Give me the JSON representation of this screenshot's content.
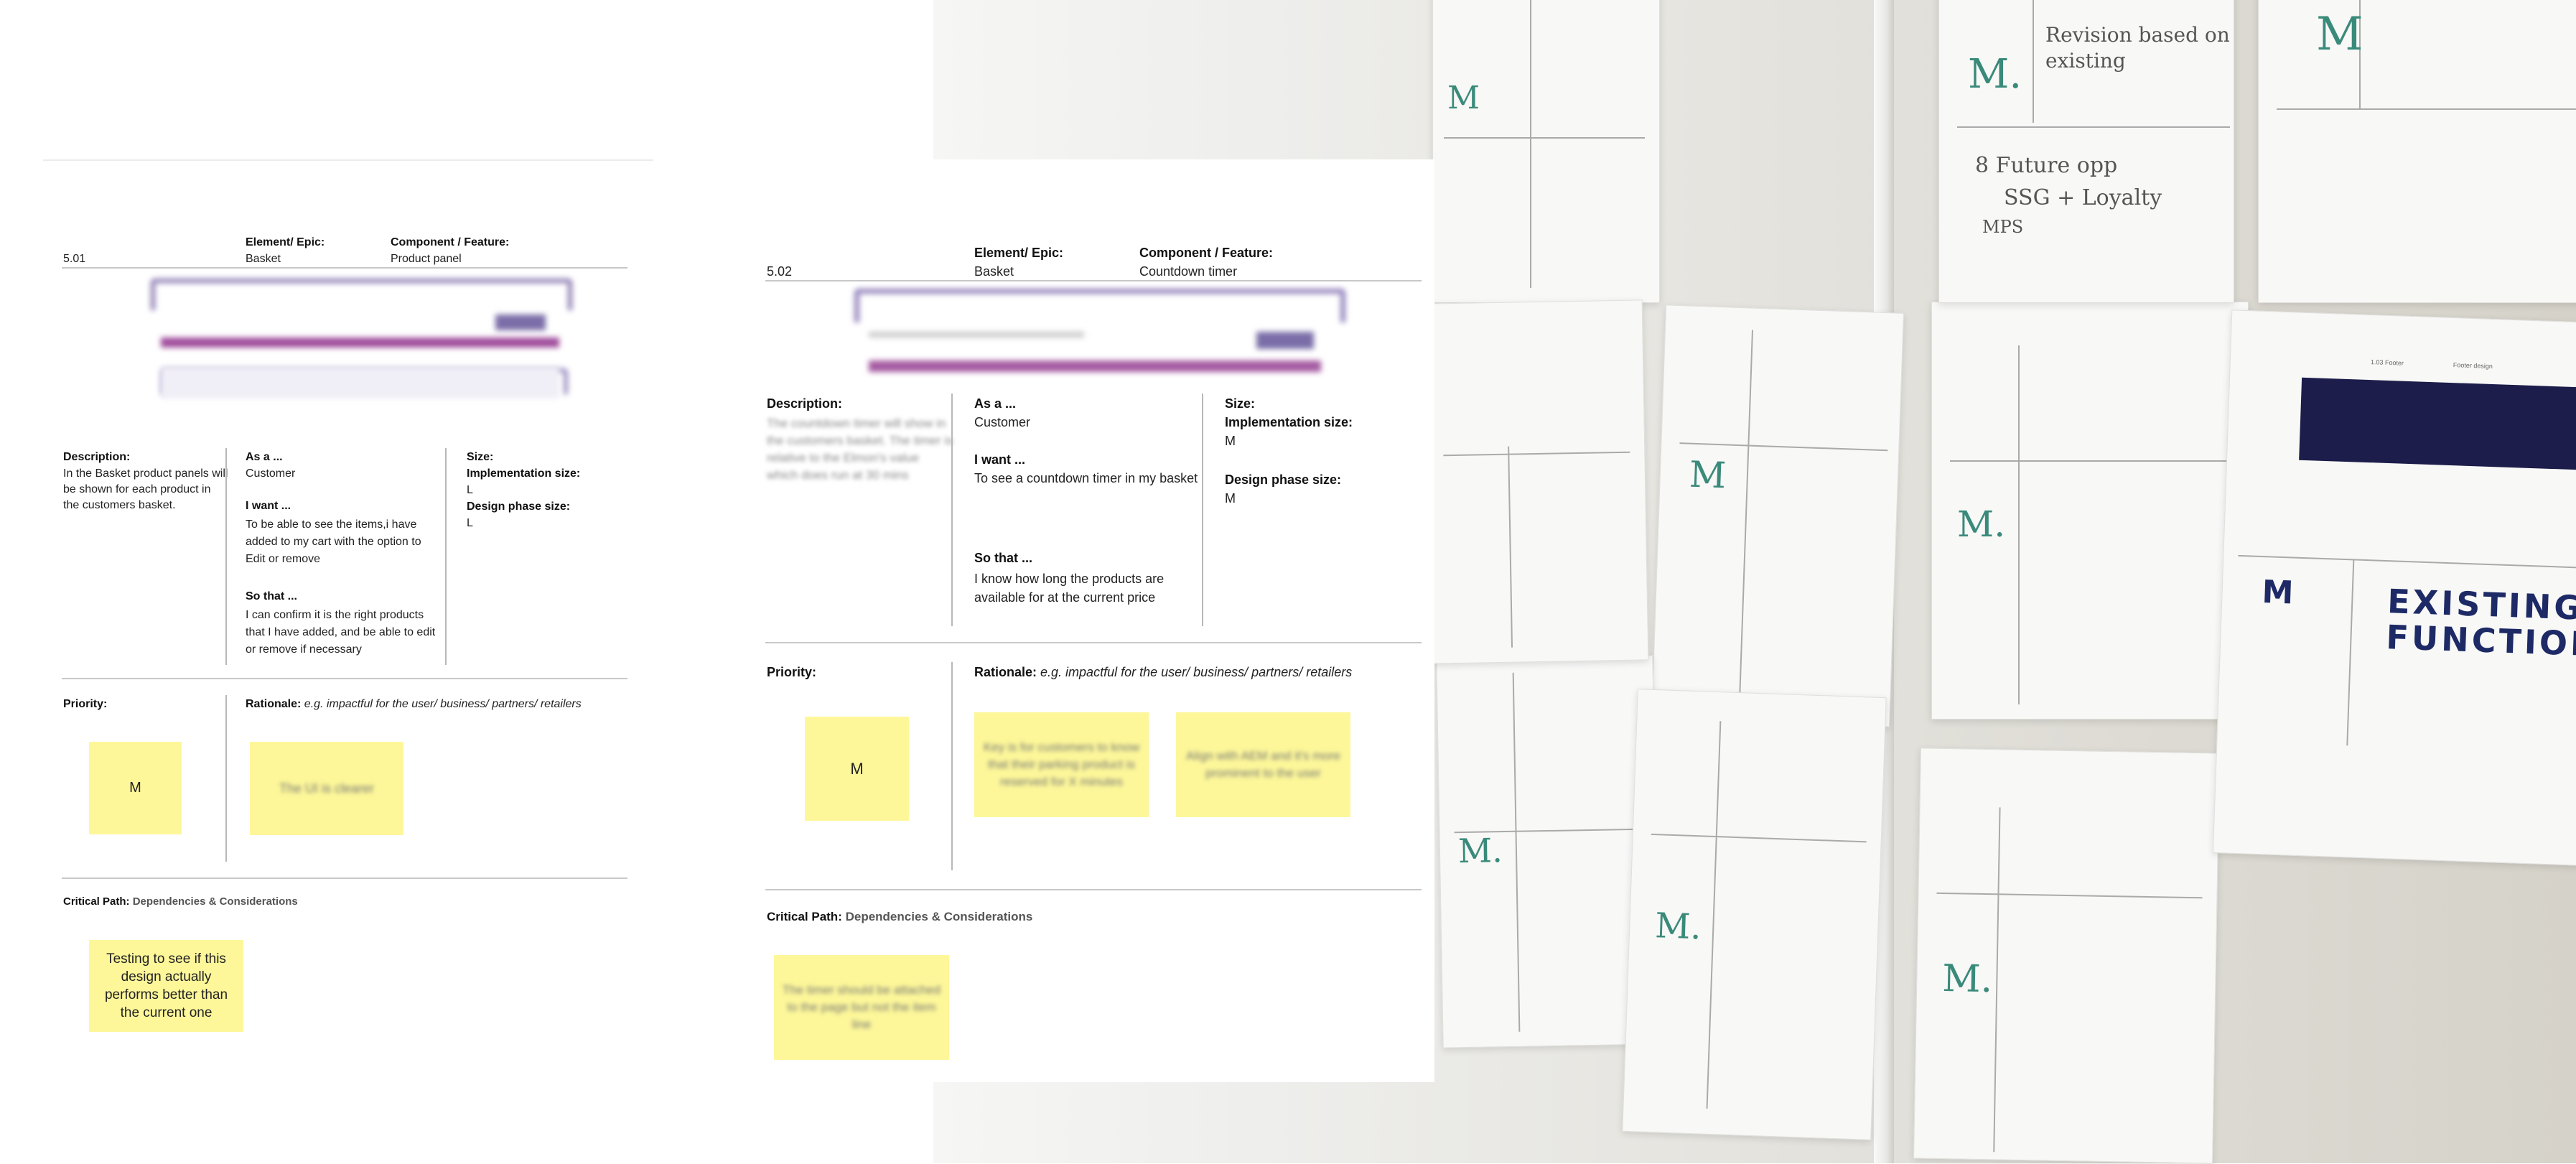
{
  "card1": {
    "id": "5.01",
    "element_label": "Element/ Epic:",
    "element_value": "Basket",
    "component_label": "Component / Feature:",
    "component_value": "Product panel",
    "description_label": "Description:",
    "description_text": "In the Basket product panels will be shown for each product in the customers basket.",
    "as_a_label": "As a ...",
    "as_a_value": "Customer",
    "i_want_label": "I want ...",
    "i_want_value": " To be able to see the items,i have added to my cart with the option to Edit or remove",
    "so_that_label": "So that ...",
    "so_that_value": "I can confirm it is the right products that I have added, and be able to edit or remove if necessary",
    "size_label": "Size:",
    "impl_label": "Implementation size:",
    "impl_value": "L",
    "design_label": "Design phase size:",
    "design_value": "L",
    "priority_label": "Priority:",
    "priority_value": "M",
    "rationale_label": "Rationale:",
    "rationale_hint": "e.g. impactful for the user/ business/ partners/ retailers",
    "rationale_note": "The UI is clearer",
    "critical_label": "Critical Path:",
    "critical_hint": "Dependencies & Considerations",
    "critical_note": "Testing to see if this design actually performs better than the current one"
  },
  "card2": {
    "id": "5.02",
    "element_label": "Element/ Epic:",
    "element_value": "Basket",
    "component_label": "Component / Feature:",
    "component_value": "Countdown timer",
    "description_label": "Description:",
    "description_text": "The countdown timer will show in the customers basket. The timer is relative to the Elmon's value which does run at 30 mins",
    "as_a_label": "As a ...",
    "as_a_value": "Customer",
    "i_want_label": "I want ...",
    "i_want_value": "To see a countdown timer in my basket",
    "so_that_label": "So that ...",
    "so_that_value": "I know how long the products are available for at the current price",
    "size_label": "Size:",
    "impl_label": "Implementation size:",
    "impl_value": "M",
    "design_label": "Design phase size:",
    "design_value": "M",
    "priority_label": "Priority:",
    "priority_value": "M",
    "rationale_label": "Rationale:",
    "rationale_hint": "e.g. impactful for the user/ business/ partners/ retailers",
    "rationale_note_1": "Key is for customers to know that their parking product is reserved for X minutes",
    "rationale_note_2": "Align with AEM and it's more prominent to the user",
    "critical_label": "Critical Path:",
    "critical_hint": "Dependencies & Considerations",
    "critical_note": "The timer should be attached to the page but not the item line"
  },
  "wall": {
    "handwriting_1": "M.",
    "handwriting_2": "Revision based on existing",
    "handwriting_3": "M.",
    "handwriting_4": "8 Future opp",
    "handwriting_5": "SSG + Loyalty",
    "handwriting_6": "MPS",
    "handwriting_7": "M",
    "handwriting_8": "M.",
    "handwriting_9": "M",
    "handwriting_10": "EXISTING",
    "handwriting_11": "FUNCTIONAL",
    "handwriting_12": "M.",
    "handwriting_13": "M",
    "handwriting_14": "M.",
    "footer_component": "Footer design",
    "footer_element": "1.03 Footer"
  }
}
